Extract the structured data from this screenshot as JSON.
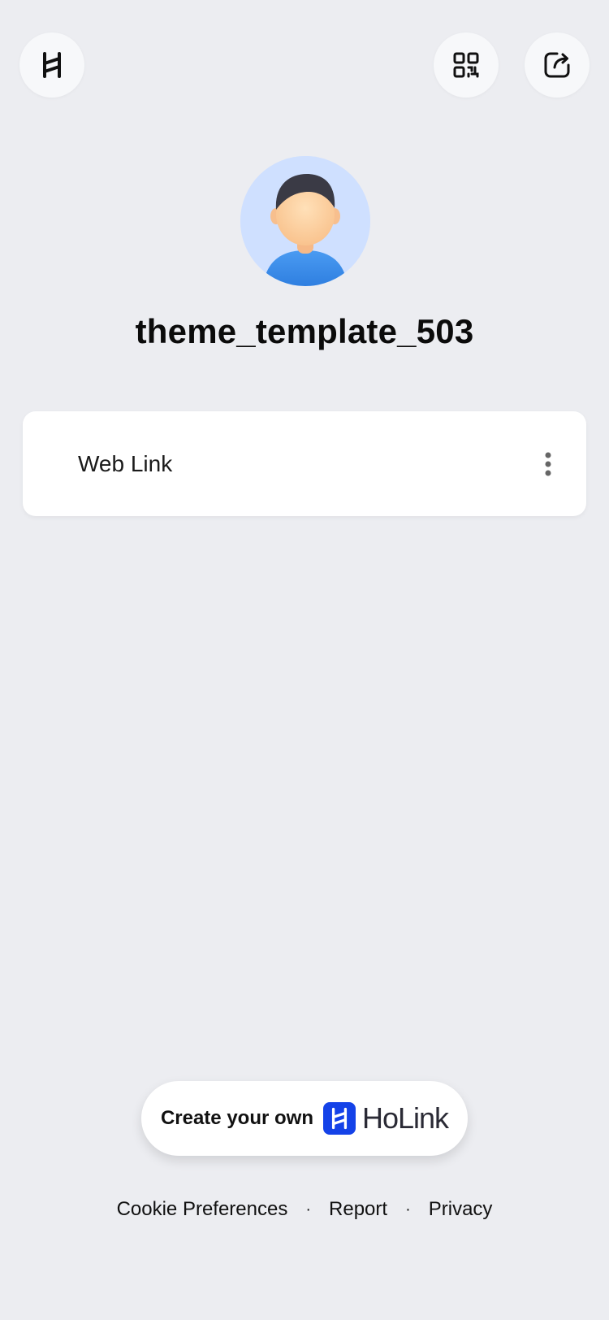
{
  "header": {
    "logo_icon": "holink-logo-icon",
    "qr_icon": "qr-code-icon",
    "share_icon": "share-icon"
  },
  "profile": {
    "avatar_icon": "default-avatar",
    "username": "theme_template_503"
  },
  "links": [
    {
      "label": "Web Link",
      "menu_icon": "more-vertical-icon"
    }
  ],
  "cta": {
    "text": "Create your own",
    "brand": "HoLink",
    "brand_color": "#1442E8"
  },
  "footer": {
    "items": [
      "Cookie Preferences",
      "Report",
      "Privacy"
    ],
    "separator": "·"
  },
  "colors": {
    "background": "#ECEDF1",
    "card": "#FFFFFF",
    "avatar_bg": "#CFE0FF"
  }
}
